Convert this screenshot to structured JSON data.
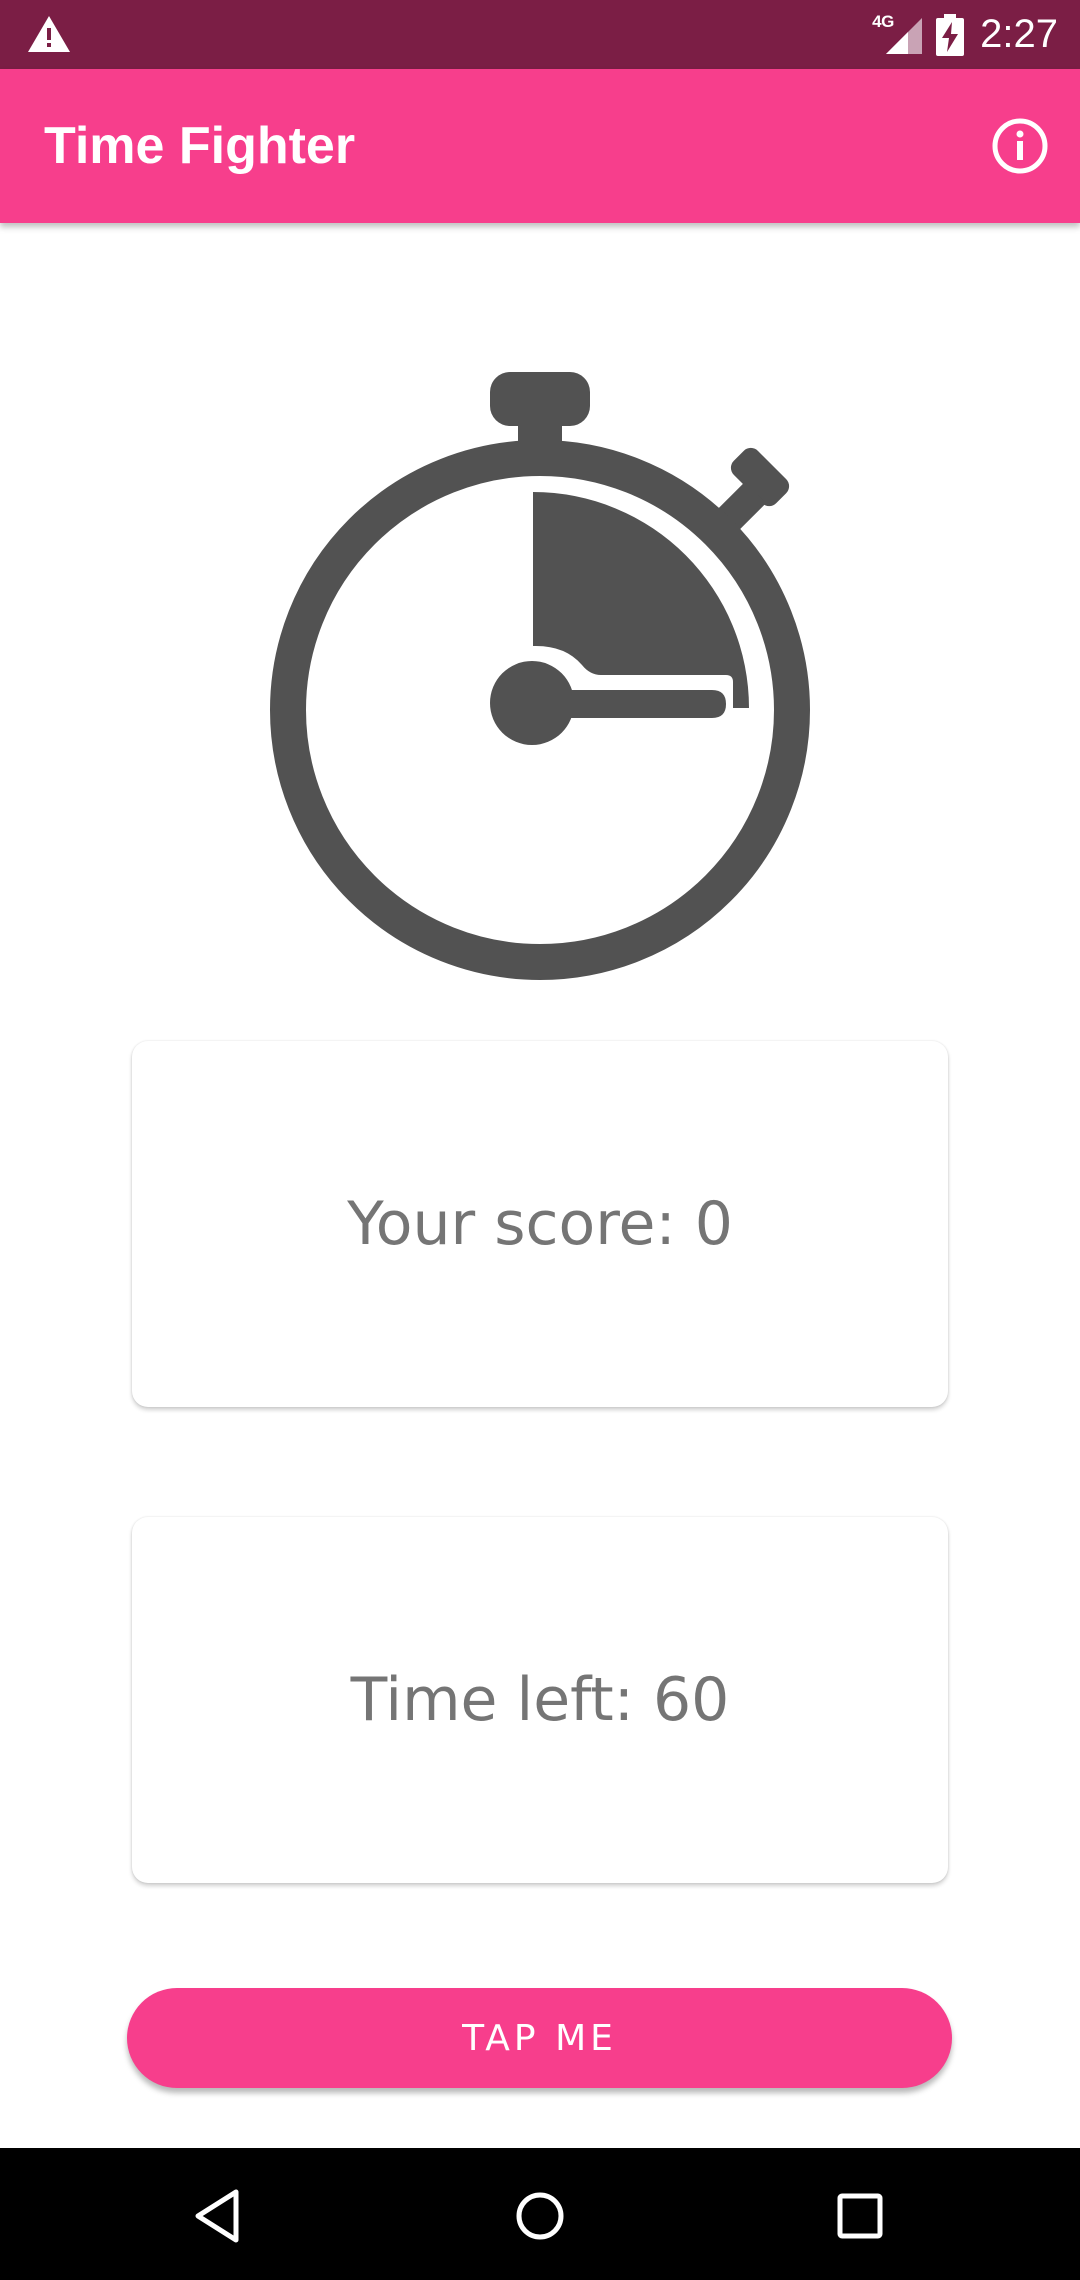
{
  "status_bar": {
    "network_label": "4G",
    "time": "2:27",
    "background": "#7b1e45",
    "icons": [
      "warning-icon",
      "signal-icon",
      "battery-charging-icon"
    ]
  },
  "app_bar": {
    "title": "Time Fighter",
    "background": "#f73e8c",
    "action_icon": "info-icon"
  },
  "illustration": {
    "icon": "stopwatch-icon",
    "color": "#525252"
  },
  "score_card": {
    "text": "Your score: 0"
  },
  "time_card": {
    "text": "Time left: 60"
  },
  "tap_button": {
    "label": "TAP ME",
    "background": "#f73e8c"
  },
  "nav_bar": {
    "background": "#000000",
    "icons": [
      "back-icon",
      "home-icon",
      "recents-icon"
    ]
  }
}
